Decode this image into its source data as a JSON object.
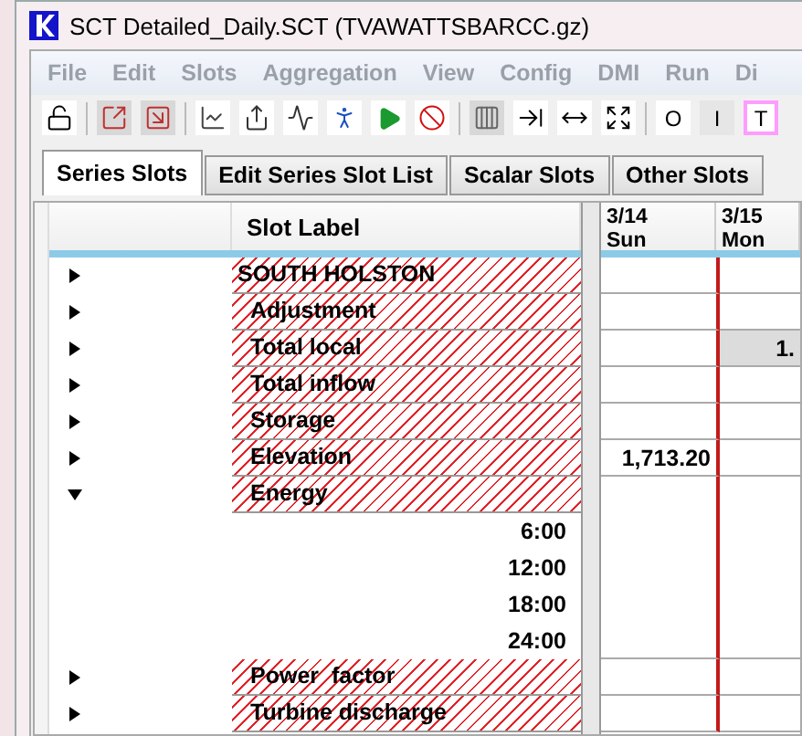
{
  "window": {
    "title": "SCT Detailed_Daily.SCT (TVAWATTSBARCC.gz)"
  },
  "menu": [
    "File",
    "Edit",
    "Slots",
    "Aggregation",
    "View",
    "Config",
    "DMI",
    "Run",
    "Di"
  ],
  "letter_buttons": [
    {
      "label": "O",
      "color": "#ffffff"
    },
    {
      "label": "I",
      "color": "#e6e6e6"
    },
    {
      "label": "T",
      "color": "#ff9cff"
    }
  ],
  "tabs": [
    {
      "label": "Series Slots",
      "selected": true
    },
    {
      "label": "Edit Series Slot List",
      "selected": false
    },
    {
      "label": "Scalar Slots",
      "selected": false
    },
    {
      "label": "Other Slots",
      "selected": false
    }
  ],
  "table": {
    "label_heading": "Slot Label",
    "date_columns": [
      {
        "date": "3/14",
        "day": "Sun"
      },
      {
        "date": "3/15",
        "day": "Mon"
      }
    ],
    "rows": [
      {
        "kind": "object",
        "label": "SOUTH HOLSTON",
        "expanded": false,
        "cells": [
          null,
          null
        ]
      },
      {
        "kind": "slot",
        "label": "Adjustment",
        "expanded": false,
        "cells": [
          null,
          null
        ]
      },
      {
        "kind": "slot",
        "label": "Total local",
        "expanded": false,
        "cells": [
          null,
          {
            "text": "1.",
            "shaded": true
          }
        ]
      },
      {
        "kind": "slot",
        "label": "Total inflow",
        "expanded": false,
        "cells": [
          null,
          null
        ]
      },
      {
        "kind": "slot",
        "label": "Storage",
        "expanded": false,
        "cells": [
          null,
          null
        ]
      },
      {
        "kind": "slot",
        "label": "Elevation",
        "expanded": false,
        "cells": [
          {
            "text": "1,713.20",
            "shaded": false
          },
          null
        ]
      },
      {
        "kind": "slot",
        "label": "Energy",
        "expanded": true,
        "cells": [
          null,
          null
        ]
      },
      {
        "kind": "timestep",
        "label": "6:00",
        "cells": [
          null,
          null
        ]
      },
      {
        "kind": "timestep",
        "label": "12:00",
        "cells": [
          null,
          null
        ]
      },
      {
        "kind": "timestep",
        "label": "18:00",
        "cells": [
          null,
          null
        ]
      },
      {
        "kind": "timestep",
        "label": "24:00",
        "cells": [
          null,
          null
        ]
      },
      {
        "kind": "slot",
        "label": "Power  factor",
        "expanded": false,
        "cells": [
          null,
          null
        ]
      },
      {
        "kind": "slot",
        "label": "Turbine discharge",
        "expanded": false,
        "cells": [
          null,
          null
        ]
      }
    ]
  }
}
